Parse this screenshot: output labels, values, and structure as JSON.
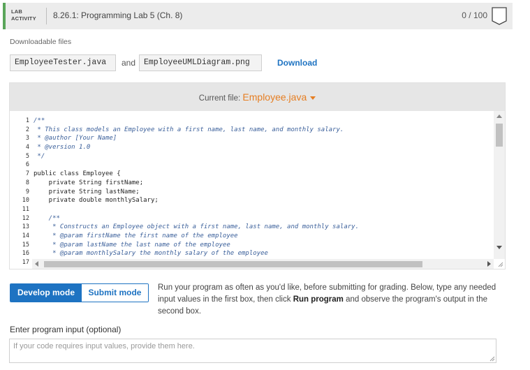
{
  "header": {
    "badge_line1": "LAB",
    "badge_line2": "ACTIVITY",
    "title": "8.26.1: Programming Lab 5 (Ch. 8)",
    "score": "0 / 100",
    "accent_color": "#5aa55a",
    "icon": "bookmark-flag-icon"
  },
  "downloads": {
    "label": "Downloadable files",
    "file1": "EmployeeTester.java",
    "conjunction": "and",
    "file2": "EmployeeUMLDiagram.png",
    "download_label": "Download"
  },
  "editor": {
    "current_file_label": "Current file:",
    "current_file": "Employee.java",
    "lines": [
      {
        "n": "1",
        "text": "/**",
        "type": "comment"
      },
      {
        "n": "2",
        "text": " * This class models an Employee with a first name, last name, and monthly salary.",
        "type": "comment"
      },
      {
        "n": "3",
        "text": " * @author [Your Name]",
        "type": "comment"
      },
      {
        "n": "4",
        "text": " * @version 1.0",
        "type": "comment"
      },
      {
        "n": "5",
        "text": " */",
        "type": "comment"
      },
      {
        "n": "6",
        "text": "",
        "type": "code"
      },
      {
        "n": "7",
        "text": "public class Employee {",
        "type": "code"
      },
      {
        "n": "8",
        "text": "    private String firstName;",
        "type": "code"
      },
      {
        "n": "9",
        "text": "    private String lastName;",
        "type": "code"
      },
      {
        "n": "10",
        "text": "    private double monthlySalary;",
        "type": "code"
      },
      {
        "n": "11",
        "text": "",
        "type": "code"
      },
      {
        "n": "12",
        "text": "    /**",
        "type": "comment"
      },
      {
        "n": "13",
        "text": "     * Constructs an Employee object with a first name, last name, and monthly salary.",
        "type": "comment"
      },
      {
        "n": "14",
        "text": "     * @param firstName the first name of the employee",
        "type": "comment"
      },
      {
        "n": "15",
        "text": "     * @param lastName the last name of the employee",
        "type": "comment"
      },
      {
        "n": "16",
        "text": "     * @param monthlySalary the monthly salary of the employee",
        "type": "comment"
      },
      {
        "n": "17",
        "text": "",
        "type": "code"
      }
    ]
  },
  "modes": {
    "develop": "Develop mode",
    "submit": "Submit mode",
    "active_color": "#1e73c2"
  },
  "instructions": {
    "part1": "Run your program as often as you'd like, before submitting for grading. Below, type any needed input values in the first box, then click ",
    "bold": "Run program",
    "part2": " and observe the program's output in the second box."
  },
  "program_input": {
    "label": "Enter program input (optional)",
    "placeholder": "If your code requires input values, provide them here.",
    "value": ""
  }
}
